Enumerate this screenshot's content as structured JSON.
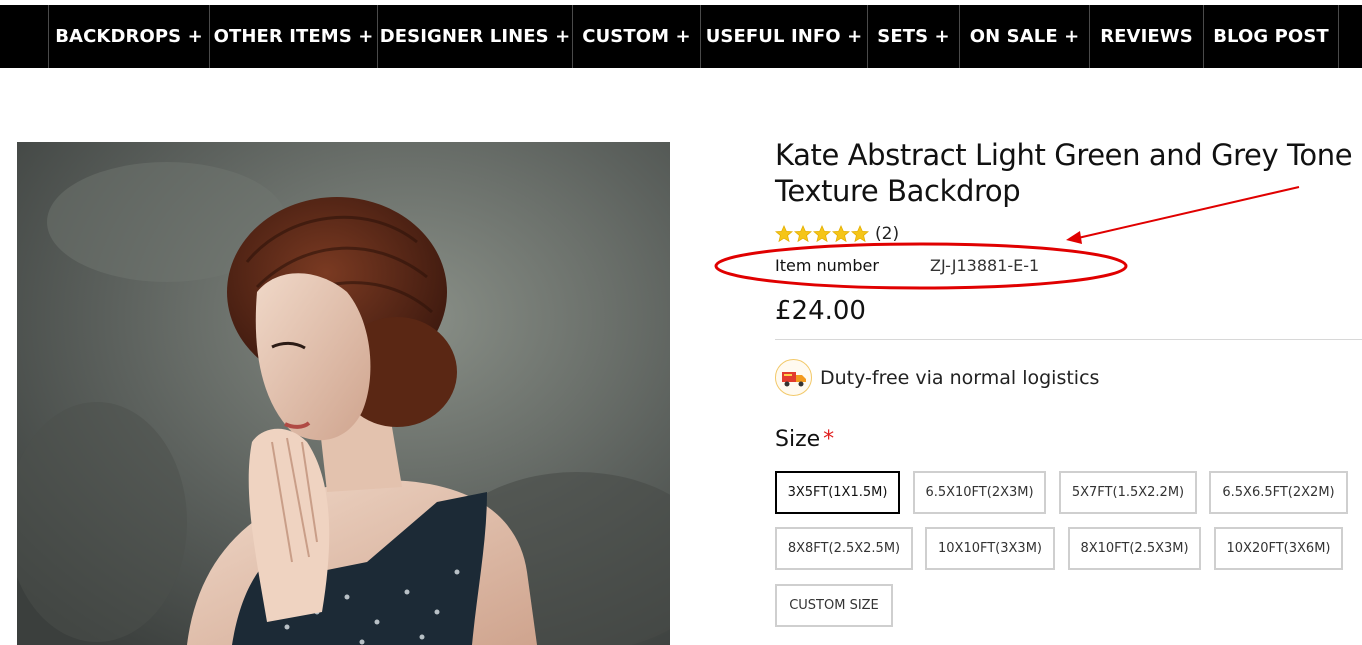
{
  "nav": {
    "items": [
      "BACKDROPS +",
      "OTHER ITEMS +",
      "DESIGNER LINES +",
      "CUSTOM +",
      "USEFUL INFO +",
      "SETS +",
      "ON SALE +",
      "REVIEWS",
      "BLOG POST"
    ]
  },
  "product": {
    "title": "Kate Abstract Light Green and Grey Tone Texture Backdrop",
    "rating": {
      "stars": 5,
      "count": "(2)"
    },
    "item_number_label": "Item number",
    "item_number": "ZJ-J13881-E-1",
    "price": "£24.00",
    "shipping_text": "Duty-free via normal logistics",
    "shipping_icon": "delivery-truck-icon"
  },
  "size": {
    "label": "Size",
    "required_mark": "*",
    "options": [
      "3X5FT(1X1.5M)",
      "6.5X10FT(2X3M)",
      "5X7FT(1.5X2.2M)",
      "6.5X6.5FT(2X2M)",
      "8X8FT(2.5X2.5M)",
      "10X10FT(3X3M)",
      "8X10FT(2.5X3M)",
      "10X20FT(3X6M)",
      "CUSTOM SIZE"
    ],
    "selected": "3X5FT(1X1.5M)"
  },
  "colors": {
    "nav_bg": "#000000",
    "star": "#f5c518",
    "annotation": "#e00000",
    "required": "#e02020"
  }
}
